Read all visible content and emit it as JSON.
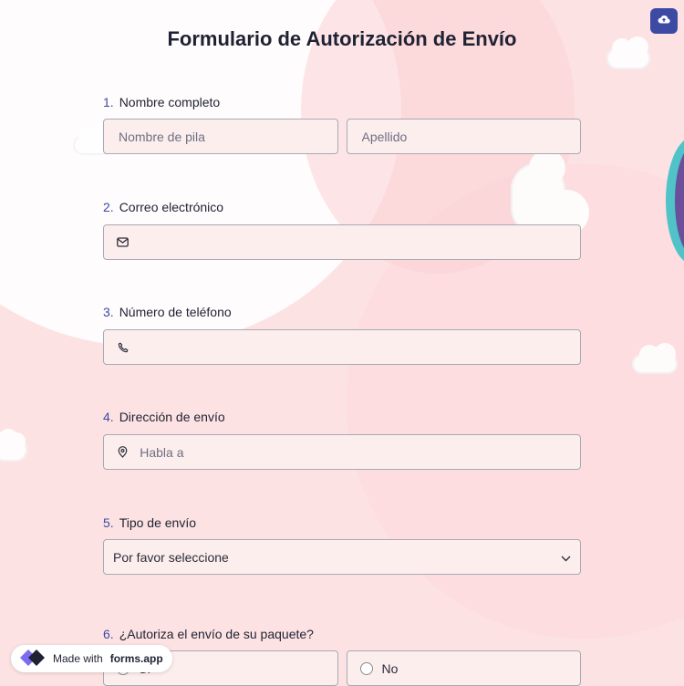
{
  "form": {
    "title": "Formulario de Autorización de Envío",
    "save_icon": "cloud-upload-icon"
  },
  "questions": [
    {
      "num": "1.",
      "label": "Nombre completo",
      "placeholders": [
        "Nombre de pila",
        "Apellido"
      ]
    },
    {
      "num": "2.",
      "label": "Correo electrónico",
      "icon": "email-icon"
    },
    {
      "num": "3.",
      "label": "Número de teléfono",
      "icon": "phone-icon"
    },
    {
      "num": "4.",
      "label": "Dirección de envío",
      "icon": "location-pin-icon",
      "placeholder": "Habla a"
    },
    {
      "num": "5.",
      "label": "Tipo de envío",
      "selected": "Por favor seleccione",
      "icon": "chevron-down-icon"
    },
    {
      "num": "6.",
      "label": "¿Autoriza el envío de su paquete?",
      "options": [
        "Sí",
        "No"
      ]
    }
  ],
  "badge": {
    "prefix": "Made with",
    "brand": "forms.app",
    "icon": "forms-app-logo-icon"
  },
  "colors": {
    "background": "#fde2e3",
    "accent": "#3d4aa3",
    "field_bg": "#fdeeee",
    "field_border": "#a8a9b6"
  }
}
